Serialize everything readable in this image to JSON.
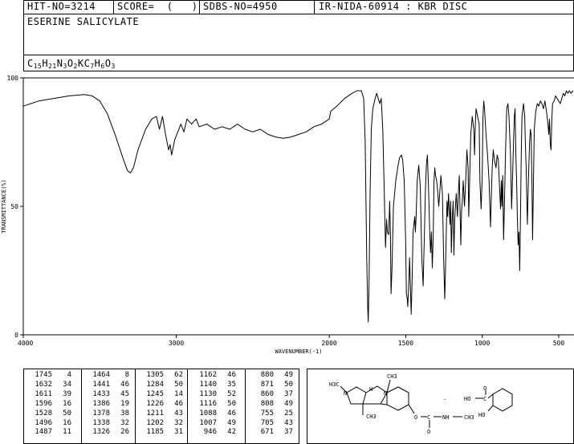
{
  "header": {
    "hit_no": "HIT-NO=3214",
    "score": "SCORE=  (   )",
    "sdbs_no": "SDBS-NO=4950",
    "ir_code": "IR-NIDA-60914 : KBR DISC"
  },
  "compound": {
    "name": "ESERINE SALICYLATE",
    "formula": "C15H21N3O2KC7H6O3",
    "formula_parts": [
      {
        "t": "C",
        "sub": false
      },
      {
        "t": "15",
        "sub": true
      },
      {
        "t": "H",
        "sub": false
      },
      {
        "t": "21",
        "sub": true
      },
      {
        "t": "N",
        "sub": false
      },
      {
        "t": "3",
        "sub": true
      },
      {
        "t": "O",
        "sub": false
      },
      {
        "t": "2",
        "sub": true
      },
      {
        "t": "KC",
        "sub": false
      },
      {
        "t": "7",
        "sub": true
      },
      {
        "t": "H",
        "sub": false
      },
      {
        "t": "6",
        "sub": true
      },
      {
        "t": "O",
        "sub": false
      },
      {
        "t": "3",
        "sub": true
      }
    ]
  },
  "structure_labels": {
    "ch3_top": "CH3",
    "h3c": "H3C",
    "n1": "N",
    "n2": "N",
    "h": "H",
    "ch3_bottom": "CH3",
    "o_link": "O",
    "c_carbonyl": "C",
    "o_carbonyl": "O",
    "nh": "NH",
    "ch3_n": "CH3",
    "dot": "·",
    "ho_acid": "HO",
    "c_acid": "C",
    "o_acid": "O",
    "ho_phenol": "HO"
  },
  "chart_data": {
    "type": "line",
    "xlabel": "WAVENUMBER(-1)",
    "ylabel": "TRANSMITTANCE(%)",
    "xlim": [
      4000,
      400
    ],
    "ylim": [
      0,
      100
    ],
    "x_ticks": [
      4000,
      3000,
      2000,
      1500,
      1000,
      500
    ],
    "y_ticks": [
      0,
      50,
      100
    ],
    "grid": false,
    "series": [
      {
        "points": [
          [
            4000,
            89
          ],
          [
            3900,
            91
          ],
          [
            3800,
            92
          ],
          [
            3700,
            93
          ],
          [
            3600,
            93.5
          ],
          [
            3550,
            93
          ],
          [
            3500,
            91
          ],
          [
            3450,
            86
          ],
          [
            3400,
            78
          ],
          [
            3350,
            69
          ],
          [
            3320,
            64
          ],
          [
            3300,
            63
          ],
          [
            3280,
            65
          ],
          [
            3250,
            72
          ],
          [
            3200,
            80
          ],
          [
            3160,
            84
          ],
          [
            3130,
            85
          ],
          [
            3110,
            80
          ],
          [
            3090,
            85
          ],
          [
            3070,
            78
          ],
          [
            3050,
            72
          ],
          [
            3040,
            74
          ],
          [
            3030,
            70
          ],
          [
            3010,
            76
          ],
          [
            2990,
            79
          ],
          [
            2970,
            82
          ],
          [
            2950,
            79
          ],
          [
            2930,
            84
          ],
          [
            2900,
            82
          ],
          [
            2870,
            84
          ],
          [
            2850,
            81
          ],
          [
            2800,
            82
          ],
          [
            2750,
            80
          ],
          [
            2700,
            81
          ],
          [
            2650,
            80
          ],
          [
            2600,
            82
          ],
          [
            2550,
            80
          ],
          [
            2500,
            79
          ],
          [
            2450,
            80
          ],
          [
            2400,
            78
          ],
          [
            2350,
            77
          ],
          [
            2300,
            76.5
          ],
          [
            2250,
            77
          ],
          [
            2200,
            78
          ],
          [
            2150,
            79
          ],
          [
            2100,
            81
          ],
          [
            2050,
            82
          ],
          [
            2000,
            84
          ],
          [
            1990,
            87
          ],
          [
            1950,
            89
          ],
          [
            1900,
            92
          ],
          [
            1850,
            94
          ],
          [
            1820,
            95
          ],
          [
            1790,
            95
          ],
          [
            1775,
            92
          ],
          [
            1765,
            75
          ],
          [
            1755,
            30
          ],
          [
            1748,
            10
          ],
          [
            1745,
            5
          ],
          [
            1740,
            20
          ],
          [
            1733,
            55
          ],
          [
            1725,
            80
          ],
          [
            1715,
            88
          ],
          [
            1700,
            92
          ],
          [
            1690,
            94
          ],
          [
            1670,
            90
          ],
          [
            1660,
            92
          ],
          [
            1650,
            80
          ],
          [
            1640,
            55
          ],
          [
            1632,
            34
          ],
          [
            1625,
            45
          ],
          [
            1620,
            40
          ],
          [
            1611,
            39
          ],
          [
            1605,
            52
          ],
          [
            1600,
            40
          ],
          [
            1596,
            16
          ],
          [
            1590,
            25
          ],
          [
            1580,
            50
          ],
          [
            1565,
            60
          ],
          [
            1550,
            66
          ],
          [
            1540,
            69
          ],
          [
            1528,
            70
          ],
          [
            1520,
            68
          ],
          [
            1510,
            60
          ],
          [
            1500,
            35
          ],
          [
            1496,
            16
          ],
          [
            1490,
            14
          ],
          [
            1487,
            11
          ],
          [
            1480,
            20
          ],
          [
            1475,
            30
          ],
          [
            1470,
            20
          ],
          [
            1464,
            8
          ],
          [
            1458,
            22
          ],
          [
            1452,
            40
          ],
          [
            1441,
            46
          ],
          [
            1437,
            40
          ],
          [
            1433,
            45
          ],
          [
            1425,
            60
          ],
          [
            1415,
            66
          ],
          [
            1405,
            58
          ],
          [
            1395,
            30
          ],
          [
            1386,
            19
          ],
          [
            1382,
            30
          ],
          [
            1378,
            38
          ],
          [
            1372,
            55
          ],
          [
            1365,
            66
          ],
          [
            1358,
            70
          ],
          [
            1350,
            55
          ],
          [
            1343,
            40
          ],
          [
            1338,
            32
          ],
          [
            1332,
            40
          ],
          [
            1326,
            26
          ],
          [
            1320,
            40
          ],
          [
            1315,
            60
          ],
          [
            1310,
            65
          ],
          [
            1305,
            62
          ],
          [
            1298,
            60
          ],
          [
            1290,
            55
          ],
          [
            1284,
            50
          ],
          [
            1278,
            55
          ],
          [
            1270,
            62
          ],
          [
            1260,
            55
          ],
          [
            1252,
            30
          ],
          [
            1245,
            14
          ],
          [
            1240,
            25
          ],
          [
            1235,
            40
          ],
          [
            1230,
            52
          ],
          [
            1226,
            46
          ],
          [
            1220,
            55
          ],
          [
            1211,
            43
          ],
          [
            1206,
            52
          ],
          [
            1202,
            32
          ],
          [
            1196,
            45
          ],
          [
            1190,
            52
          ],
          [
            1185,
            31
          ],
          [
            1180,
            45
          ],
          [
            1170,
            55
          ],
          [
            1162,
            46
          ],
          [
            1156,
            55
          ],
          [
            1150,
            62
          ],
          [
            1140,
            35
          ],
          [
            1135,
            48
          ],
          [
            1130,
            52
          ],
          [
            1124,
            60
          ],
          [
            1116,
            50
          ],
          [
            1108,
            60
          ],
          [
            1100,
            72
          ],
          [
            1092,
            65
          ],
          [
            1088,
            46
          ],
          [
            1082,
            60
          ],
          [
            1075,
            78
          ],
          [
            1065,
            85
          ],
          [
            1055,
            80
          ],
          [
            1050,
            70
          ],
          [
            1045,
            82
          ],
          [
            1040,
            88
          ],
          [
            1030,
            85
          ],
          [
            1020,
            82
          ],
          [
            1015,
            60
          ],
          [
            1007,
            49
          ],
          [
            1000,
            62
          ],
          [
            995,
            85
          ],
          [
            990,
            91
          ],
          [
            985,
            88
          ],
          [
            975,
            78
          ],
          [
            965,
            70
          ],
          [
            955,
            60
          ],
          [
            946,
            42
          ],
          [
            940,
            55
          ],
          [
            935,
            65
          ],
          [
            928,
            72
          ],
          [
            920,
            68
          ],
          [
            910,
            65
          ],
          [
            902,
            70
          ],
          [
            895,
            68
          ],
          [
            880,
            49
          ],
          [
            875,
            60
          ],
          [
            871,
            50
          ],
          [
            866,
            62
          ],
          [
            860,
            37
          ],
          [
            855,
            50
          ],
          [
            848,
            70
          ],
          [
            840,
            88
          ],
          [
            832,
            90
          ],
          [
            825,
            85
          ],
          [
            815,
            70
          ],
          [
            808,
            49
          ],
          [
            800,
            65
          ],
          [
            795,
            75
          ],
          [
            790,
            85
          ],
          [
            785,
            88
          ],
          [
            780,
            70
          ],
          [
            775,
            60
          ],
          [
            770,
            45
          ],
          [
            765,
            35
          ],
          [
            760,
            40
          ],
          [
            755,
            25
          ],
          [
            750,
            45
          ],
          [
            745,
            70
          ],
          [
            740,
            85
          ],
          [
            730,
            90
          ],
          [
            722,
            85
          ],
          [
            718,
            75
          ],
          [
            713,
            65
          ],
          [
            705,
            43
          ],
          [
            698,
            60
          ],
          [
            690,
            75
          ],
          [
            685,
            80
          ],
          [
            680,
            78
          ],
          [
            675,
            60
          ],
          [
            671,
            37
          ],
          [
            666,
            55
          ],
          [
            660,
            80
          ],
          [
            650,
            87
          ],
          [
            640,
            90
          ],
          [
            630,
            89
          ],
          [
            620,
            91
          ],
          [
            610,
            90
          ],
          [
            600,
            88
          ],
          [
            590,
            91
          ],
          [
            580,
            87
          ],
          [
            570,
            82
          ],
          [
            565,
            78
          ],
          [
            560,
            84
          ],
          [
            555,
            74
          ],
          [
            550,
            72
          ],
          [
            545,
            84
          ],
          [
            540,
            90
          ],
          [
            530,
            91
          ],
          [
            520,
            93
          ],
          [
            510,
            92
          ],
          [
            500,
            91
          ],
          [
            490,
            90
          ],
          [
            480,
            92
          ],
          [
            470,
            94
          ],
          [
            460,
            93
          ],
          [
            450,
            95
          ],
          [
            440,
            94
          ],
          [
            430,
            95
          ],
          [
            420,
            94
          ],
          [
            405,
            95
          ]
        ]
      }
    ]
  },
  "peak_table": {
    "columns": [
      [
        [
          "1745",
          "4"
        ],
        [
          "1632",
          "34"
        ],
        [
          "1611",
          "39"
        ],
        [
          "1596",
          "16"
        ],
        [
          "1528",
          "50"
        ],
        [
          "1496",
          "16"
        ],
        [
          "1487",
          "11"
        ]
      ],
      [
        [
          "1464",
          "8"
        ],
        [
          "1441",
          "46"
        ],
        [
          "1433",
          "45"
        ],
        [
          "1386",
          "19"
        ],
        [
          "1378",
          "38"
        ],
        [
          "1338",
          "32"
        ],
        [
          "1326",
          "26"
        ]
      ],
      [
        [
          "1305",
          "62"
        ],
        [
          "1284",
          "50"
        ],
        [
          "1245",
          "14"
        ],
        [
          "1226",
          "46"
        ],
        [
          "1211",
          "43"
        ],
        [
          "1202",
          "32"
        ],
        [
          "1185",
          "31"
        ]
      ],
      [
        [
          "1162",
          "46"
        ],
        [
          "1140",
          "35"
        ],
        [
          "1130",
          "52"
        ],
        [
          "1116",
          "50"
        ],
        [
          "1088",
          "46"
        ],
        [
          "1007",
          "49"
        ],
        [
          "946",
          "42"
        ]
      ],
      [
        [
          "880",
          "49"
        ],
        [
          "871",
          "50"
        ],
        [
          "860",
          "37"
        ],
        [
          "808",
          "49"
        ],
        [
          "755",
          "25"
        ],
        [
          "705",
          "43"
        ],
        [
          "671",
          "37"
        ]
      ]
    ]
  }
}
